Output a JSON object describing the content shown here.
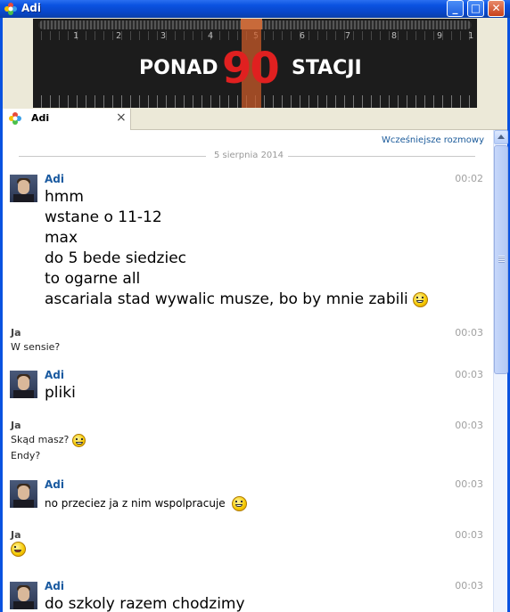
{
  "window": {
    "title": "Adi",
    "buttons": {
      "minimize": "_",
      "maximize": "□",
      "close": "✕"
    }
  },
  "banner": {
    "word1": "PONAD",
    "number": "90",
    "word2": "STACJI",
    "ruler_numbers": [
      "1",
      "2",
      "3",
      "4",
      "5",
      "6",
      "7",
      "8",
      "9",
      "1"
    ]
  },
  "tab": {
    "label": "Adi",
    "close": "×"
  },
  "chat": {
    "earlier_link": "Wcześniejsze rozmowy",
    "date": "5 sierpnia 2014",
    "messages": [
      {
        "sender": "Adi",
        "time": "00:02",
        "lines": [
          "hmm",
          "wstane o 11-12",
          "max",
          "do 5 bede siedziec",
          "to ogarne all",
          "ascariala stad wywalic musze, bo by mnie zabili"
        ]
      },
      {
        "sender": "Ja",
        "time": "00:03",
        "lines": [
          "W sensie?"
        ]
      },
      {
        "sender": "Adi",
        "time": "00:03",
        "lines": [
          "pliki"
        ]
      },
      {
        "sender": "Ja",
        "time": "00:03",
        "lines": [
          "Skąd masz?",
          "Endy?"
        ]
      },
      {
        "sender": "Adi",
        "time": "00:03",
        "lines": [
          "no przeciez ja z nim wspolpracuje"
        ]
      },
      {
        "sender": "Ja",
        "time": "00:03",
        "lines": []
      },
      {
        "sender": "Adi",
        "time": "00:03",
        "lines": [
          "do szkoly razem chodzimy"
        ]
      }
    ]
  },
  "icons": {
    "app": "gadu-gadu-flower-icon",
    "emoticon_grin": "grin-emoticon-icon",
    "emoticon_wink": "wink-emoticon-icon"
  },
  "colors": {
    "titlebar": "#0a52e0",
    "sender_adi": "#1a5aa0",
    "link": "#1a5a9a",
    "time": "#a0a0a0",
    "banner_number": "#e02020"
  }
}
